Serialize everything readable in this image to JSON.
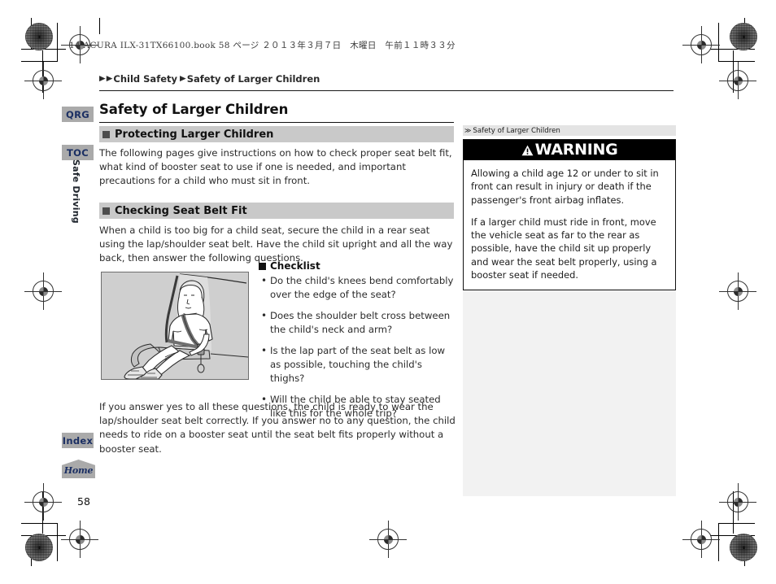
{
  "book_header": "14 ACURA ILX-31TX66100.book  58 ページ  ２０１３年３月７日　木曜日　午前１１時３３分",
  "breadcrumb": {
    "arrow_glyph": "▶",
    "parent": "Child Safety",
    "current": "Safety of Larger Children"
  },
  "rail": {
    "qrg": "QRG",
    "toc": "TOC",
    "chapter": "Safe Driving",
    "index": "Index",
    "home": "Home"
  },
  "page": {
    "title": "Safety of Larger Children",
    "number": "58"
  },
  "sections": {
    "protecting": {
      "heading": "Protecting Larger Children",
      "body": "The following pages give instructions on how to check proper seat belt fit, what kind of booster seat to use if one is needed, and important precautions for a child who must sit in front."
    },
    "checking": {
      "heading": "Checking Seat Belt Fit",
      "body": "When a child is too big for a child seat, secure the child in a rear seat using the lap/shoulder seat belt. Have the child sit upright and all the way back, then answer the following questions.",
      "closing": "If you answer yes to all these questions, the child is ready to wear the lap/shoulder seat belt correctly. If you answer no to any question, the child needs to ride on a booster seat until the seat belt fits properly without a booster seat."
    }
  },
  "checklist": {
    "heading": "Checklist",
    "bullet_glyph": "•",
    "items": [
      "Do the child's knees bend comfortably over the edge of the seat?",
      "Does the shoulder belt cross between the child's neck and arm?",
      "Is the lap part of the seat belt as low as possible, touching the child's thighs?",
      "Will the child be able to stay seated like this for the whole trip?"
    ]
  },
  "illustration": {
    "caption": "child seated in rear seat wearing lap/shoulder belt"
  },
  "right_column": {
    "reference_mark": "≫",
    "reference_label": "Safety of Larger Children",
    "warning_label": "WARNING",
    "warning_paragraphs": [
      "Allowing a child age 12 or under to sit in front can result in injury or death if the passenger's front airbag inflates.",
      "If a larger child must ride in front, move the vehicle seat as far to the rear as possible, have the child sit up properly and wear the seat belt properly, using a booster seat if needed."
    ]
  },
  "colors": {
    "section_bar": "#c9c9c9",
    "rail_button": "#aaaaaa",
    "rail_text": "#1b2f63",
    "warning_bar": "#000000",
    "filler_panel": "#f2f2f2"
  }
}
